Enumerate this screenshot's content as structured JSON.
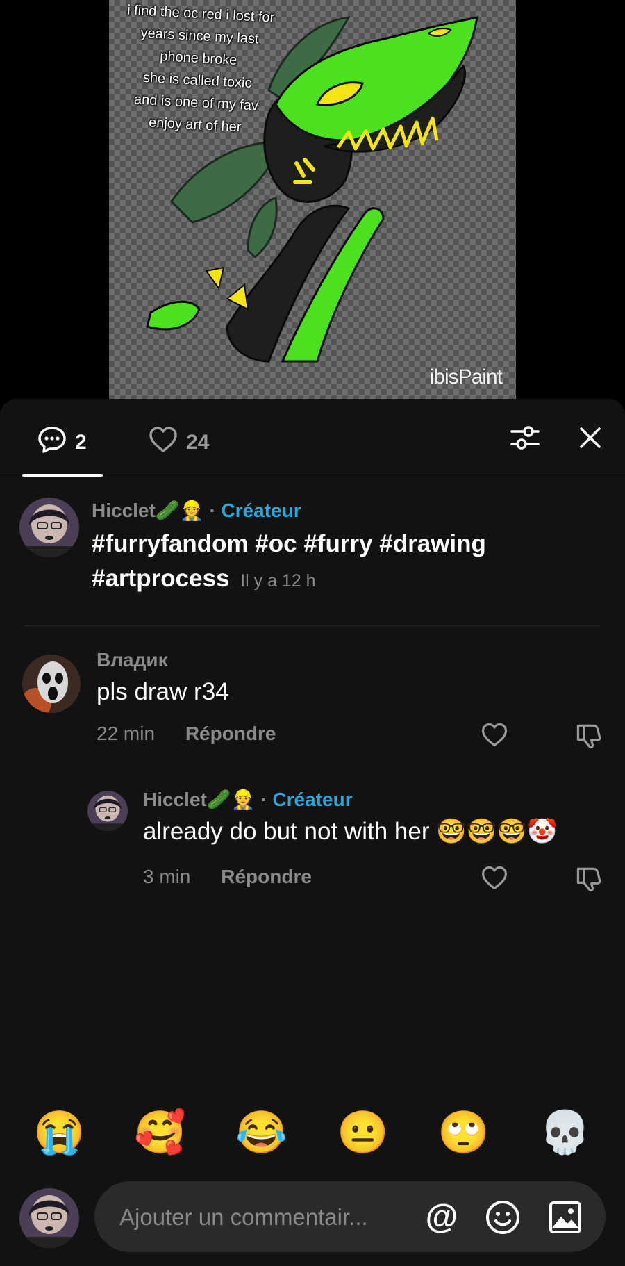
{
  "artwork": {
    "caption_lines": [
      "i find the oc red i lost for",
      "years since my last",
      "phone broke",
      "she is called toxic",
      "and is one of my fav",
      "enjoy art of her"
    ],
    "watermark": "ibisPaint",
    "colors": {
      "green": "#4be11c",
      "yellow": "#f6e312",
      "leaf": "#3c6b45",
      "dark": "#1c1f1c"
    }
  },
  "header": {
    "comment_count": "2",
    "like_count": "24",
    "icons": [
      "comment-icon",
      "heart-icon",
      "filter-sliders-icon",
      "close-icon"
    ]
  },
  "creator_caption": {
    "username": "Hicclet🥒👷",
    "creator_badge": "Créateur",
    "text": "#furryfandom #oc #furry #drawing #artprocess",
    "time": "Il y a 12 h"
  },
  "comments": [
    {
      "username": "Владик",
      "text": "pls draw r34",
      "time": "22 min",
      "reply_label": "Répondre",
      "replies": [
        {
          "username": "Hicclet🥒👷",
          "creator_badge": "Créateur",
          "text": "already do but not with her 🤓🤓🤓🤡",
          "time": "3 min",
          "reply_label": "Répondre"
        }
      ]
    }
  ],
  "quick_reactions": [
    "😭",
    "🥰",
    "😂",
    "😐",
    "🙄",
    "💀"
  ],
  "composer": {
    "placeholder": "Ajouter un commentair...",
    "mention": "@",
    "icons": [
      "at-icon",
      "emoji-icon",
      "image-icon"
    ]
  },
  "colors": {
    "accent_creator": "#2aa7d8",
    "panel_bg": "#121212",
    "muted_text": "#8a8a8a"
  }
}
